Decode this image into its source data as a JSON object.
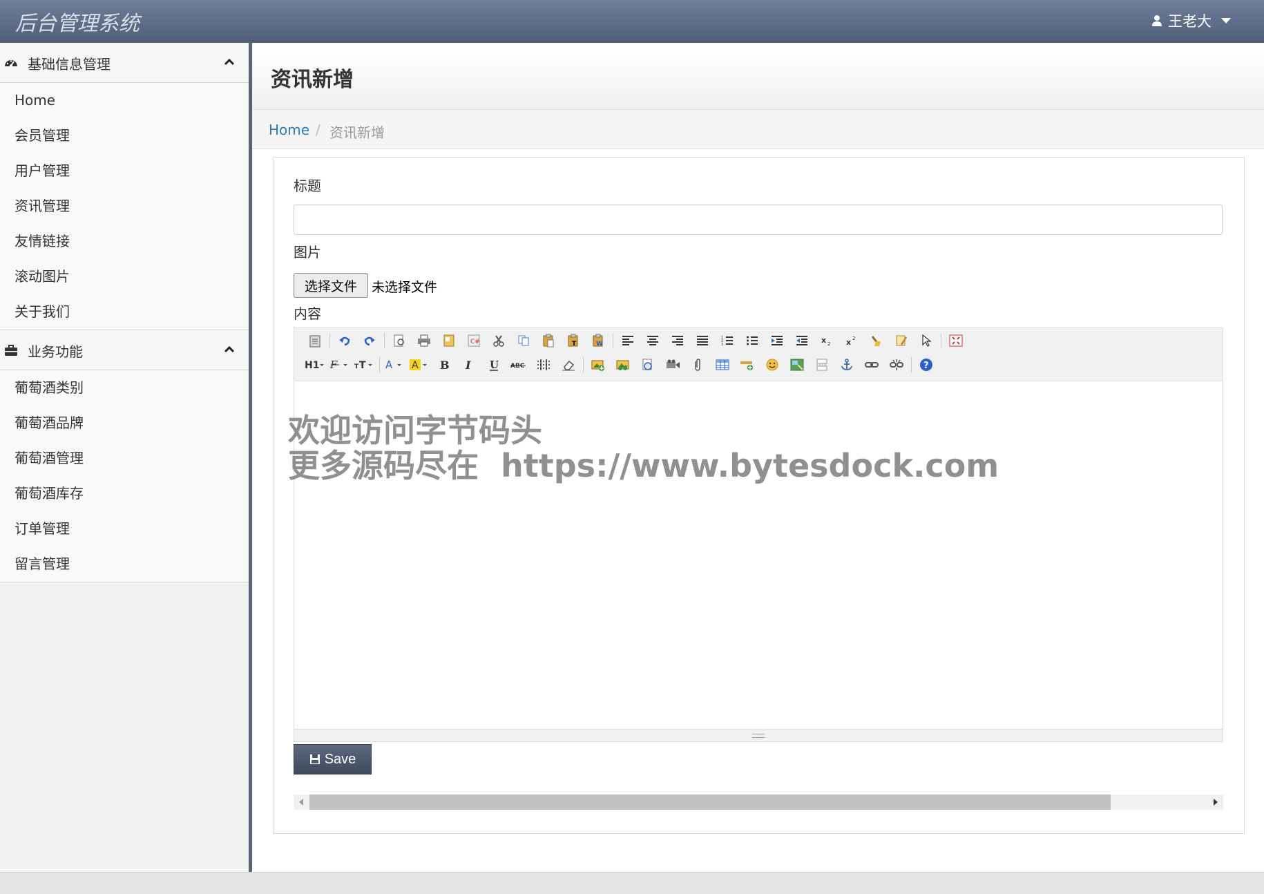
{
  "header": {
    "brand": "后台管理系统",
    "user_name": "王老大"
  },
  "sidebar": {
    "groups": [
      {
        "title": "基础信息管理",
        "icon": "dashboard-icon",
        "expanded": true,
        "items": [
          "Home",
          "会员管理",
          "用户管理",
          "资讯管理",
          "友情链接",
          "滚动图片",
          "关于我们"
        ]
      },
      {
        "title": "业务功能",
        "icon": "briefcase-icon",
        "expanded": true,
        "items": [
          "葡萄酒类别",
          "葡萄酒品牌",
          "葡萄酒管理",
          "葡萄酒库存",
          "订单管理",
          "留言管理"
        ]
      }
    ]
  },
  "page": {
    "title": "资讯新增"
  },
  "breadcrumb": {
    "home": "Home",
    "separator": "/",
    "current": "资讯新增"
  },
  "form": {
    "title_label": "标题",
    "title_value": "",
    "image_label": "图片",
    "file_button": "选择文件",
    "file_status": "未选择文件",
    "content_label": "内容",
    "save_label": "Save"
  },
  "editor": {
    "toolbar_row1": [
      "source-icon",
      "undo-icon",
      "redo-icon",
      "preview-icon",
      "print-icon",
      "template-icon",
      "code-icon",
      "cut-icon",
      "copy-icon",
      "paste-icon",
      "paste-plain-icon",
      "paste-word-icon",
      "align-left-icon",
      "align-center-icon",
      "align-right-icon",
      "justify-icon",
      "ordered-list-icon",
      "unordered-list-icon",
      "indent-icon",
      "outdent-icon",
      "subscript-icon",
      "superscript-icon",
      "clear-html-icon",
      "quick-format-icon",
      "select-all-icon",
      "fullscreen-icon"
    ],
    "toolbar_row2": [
      "heading-icon",
      "font-family-icon",
      "font-size-icon",
      "fore-color-icon",
      "highlight-color-icon",
      "bold-icon",
      "italic-icon",
      "underline-icon",
      "strikethrough-icon",
      "line-height-icon",
      "remove-format-icon",
      "image-icon",
      "multi-image-icon",
      "flash-icon",
      "media-icon",
      "attachment-icon",
      "table-icon",
      "horizontal-rule-icon",
      "emoticon-icon",
      "baidu-map-icon",
      "page-break-icon",
      "anchor-icon",
      "link-icon",
      "unlink-icon",
      "about-icon"
    ]
  },
  "watermark": {
    "line1": "欢迎访问字节码头",
    "line2": "更多源码尽在  https://www.bytesdock.com"
  },
  "colors": {
    "topbar": "#5d6a86",
    "sidebar_border": "#5a6274",
    "link": "#2a7ab7",
    "save_button": "#4d5769"
  }
}
